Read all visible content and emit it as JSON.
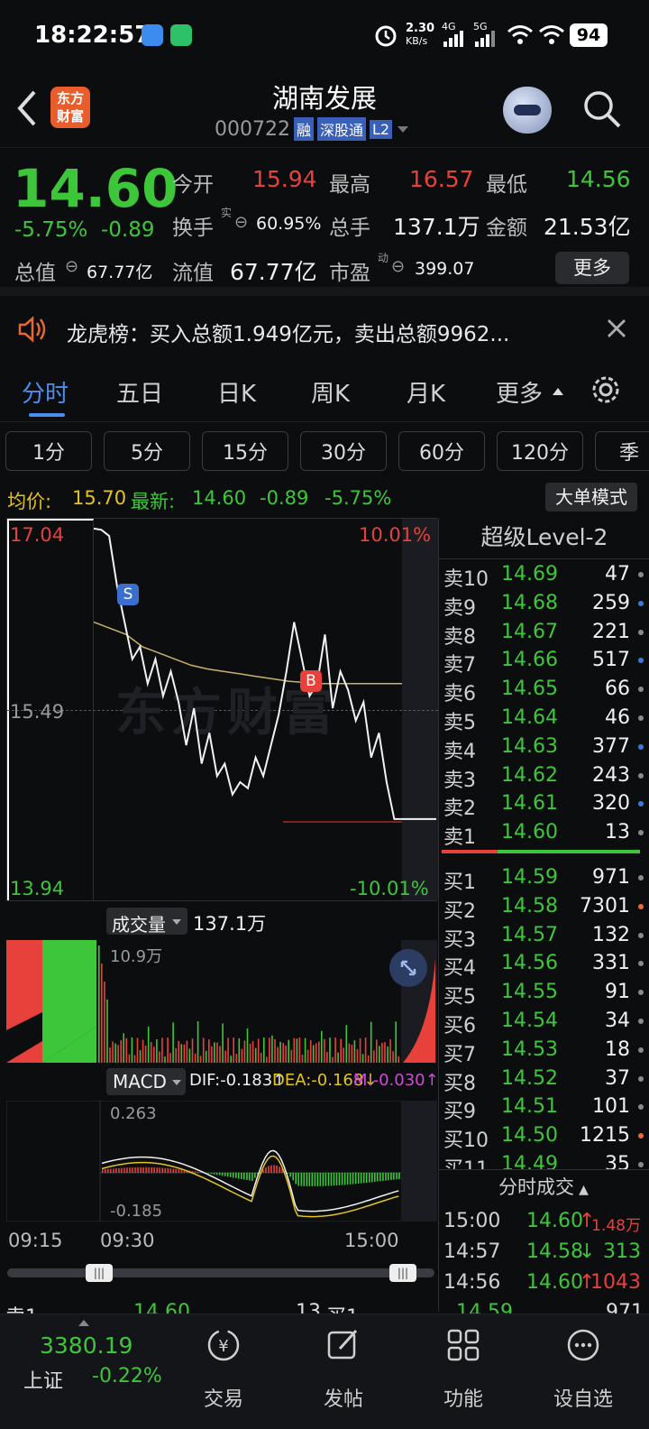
{
  "status_bar": {
    "time": "18:22:57",
    "net_speed_value": "2.30",
    "net_speed_unit": "KB/s",
    "net_4g": "4G",
    "net_5g": "5G",
    "battery": "94"
  },
  "header": {
    "title": "湖南发展",
    "code": "000722",
    "badge_margin": "融",
    "badge_connect": "深股通",
    "badge_level": "L2",
    "logo_line1": "东方",
    "logo_line2": "财富"
  },
  "quote": {
    "price": "14.60",
    "change_pct": "-5.75%",
    "change": "-0.89",
    "open_label": "今开",
    "open": "15.94",
    "high_label": "最高",
    "high": "16.57",
    "low_label": "最低",
    "low": "14.56",
    "turnover_label": "换手",
    "turnover_sup": "实",
    "turnover": "60.95%",
    "volume_label": "总手",
    "volume": "137.1万",
    "amount_label": "金额",
    "amount": "21.53亿",
    "mktcap_label": "总值",
    "mktcap": "67.77亿",
    "float_label": "流值",
    "float": "67.77亿",
    "pe_label": "市盈",
    "pe_sup": "动",
    "pe": "399.07",
    "more_button": "更多"
  },
  "notice": {
    "text": "龙虎榜：买入总额1.949亿元，卖出总额9962..."
  },
  "tabs": [
    "分时",
    "五日",
    "日K",
    "周K",
    "月K",
    "更多"
  ],
  "periods": [
    "1分",
    "5分",
    "15分",
    "30分",
    "60分",
    "120分",
    "季"
  ],
  "info_line": {
    "avg_label": "均价:",
    "avg": "15.70",
    "latest_label": "最新:",
    "latest": "14.60",
    "chg": "-0.89",
    "pct": "-5.75%",
    "big_order_button": "大单模式"
  },
  "chart": {
    "y_top": "17.04",
    "y_mid": "15.49",
    "y_bottom": "13.94",
    "pct_top": "10.01%",
    "pct_bottom": "-10.01%",
    "volume_label": "成交量",
    "volume_total": "137.1万",
    "volume_max": "10.9万",
    "macd_label": "MACD",
    "dif": "DIF:-0.183↑",
    "dea": "DEA:-0.168↓",
    "m": "M:-0.030↑",
    "macd_top": "0.263",
    "macd_bottom": "-0.185",
    "time_start": "09:15",
    "time_open": "09:30",
    "time_end": "15:00",
    "marker_s": "S",
    "marker_b": "B",
    "watermark": "东方财富"
  },
  "chart_data": {
    "type": "line",
    "title": "分时",
    "series": [
      {
        "name": "最新",
        "values": [
          16.96,
          16.95,
          16.9,
          16.5,
          16.2,
          15.9,
          16.0,
          15.7,
          15.9,
          15.6,
          15.8,
          15.55,
          15.2,
          15.5,
          15.05,
          15.3,
          14.95,
          15.05,
          14.8,
          14.9,
          14.85,
          15.1,
          14.95,
          15.2,
          15.45,
          15.8,
          16.2,
          15.9,
          15.6,
          15.7,
          16.1,
          15.5,
          15.8,
          15.65,
          15.4,
          15.55,
          15.1,
          15.3,
          14.9,
          14.6,
          14.6
        ]
      },
      {
        "name": "均价",
        "values": [
          16.2,
          16.15,
          16.1,
          16.0,
          15.95,
          15.9,
          15.85,
          15.82,
          15.8,
          15.78,
          15.76,
          15.74,
          15.72,
          15.71,
          15.7,
          15.7,
          15.7,
          15.7,
          15.7,
          15.7
        ]
      }
    ],
    "ylim": [
      13.94,
      17.04
    ],
    "xticks": [
      "09:15",
      "09:30",
      "15:00"
    ]
  },
  "order_book": {
    "title": "超级Level-2",
    "sells": [
      {
        "label": "卖10",
        "price": "14.69",
        "vol": "47",
        "dot": "#8a8a8a"
      },
      {
        "label": "卖9",
        "price": "14.68",
        "vol": "259",
        "dot": "#3a7bd5"
      },
      {
        "label": "卖8",
        "price": "14.67",
        "vol": "221",
        "dot": "#8a8a8a"
      },
      {
        "label": "卖7",
        "price": "14.66",
        "vol": "517",
        "dot": "#3a7bd5"
      },
      {
        "label": "卖6",
        "price": "14.65",
        "vol": "66",
        "dot": "#8a8a8a"
      },
      {
        "label": "卖5",
        "price": "14.64",
        "vol": "46",
        "dot": "#8a8a8a"
      },
      {
        "label": "卖4",
        "price": "14.63",
        "vol": "377",
        "dot": "#3a7bd5"
      },
      {
        "label": "卖3",
        "price": "14.62",
        "vol": "243",
        "dot": "#8a8a8a"
      },
      {
        "label": "卖2",
        "price": "14.61",
        "vol": "320",
        "dot": "#3a7bd5"
      },
      {
        "label": "卖1",
        "price": "14.60",
        "vol": "13",
        "dot": "#8a8a8a"
      }
    ],
    "buys": [
      {
        "label": "买1",
        "price": "14.59",
        "vol": "971",
        "dot": "#8a8a8a"
      },
      {
        "label": "买2",
        "price": "14.58",
        "vol": "7301",
        "dot": "#e86a3c"
      },
      {
        "label": "买3",
        "price": "14.57",
        "vol": "132",
        "dot": "#8a8a8a"
      },
      {
        "label": "买4",
        "price": "14.56",
        "vol": "331",
        "dot": "#8a8a8a"
      },
      {
        "label": "买5",
        "price": "14.55",
        "vol": "91",
        "dot": "#8a8a8a"
      },
      {
        "label": "买6",
        "price": "14.54",
        "vol": "34",
        "dot": "#8a8a8a"
      },
      {
        "label": "买7",
        "price": "14.53",
        "vol": "18",
        "dot": "#8a8a8a"
      },
      {
        "label": "买8",
        "price": "14.52",
        "vol": "37",
        "dot": "#8a8a8a"
      },
      {
        "label": "买9",
        "price": "14.51",
        "vol": "101",
        "dot": "#8a8a8a"
      },
      {
        "label": "买10",
        "price": "14.50",
        "vol": "1215",
        "dot": "#e86a3c"
      },
      {
        "label": "买11",
        "price": "14.49",
        "vol": "35",
        "dot": "#8a8a8a"
      }
    ],
    "trades_title": "分时成交",
    "trades": [
      {
        "time": "15:00",
        "price": "14.60",
        "arrow": "↑",
        "vol": "1.48万"
      },
      {
        "time": "14:57",
        "price": "14.58",
        "arrow": "↓",
        "vol": "313"
      },
      {
        "time": "14:56",
        "price": "14.60",
        "arrow": "↑",
        "vol": "1043"
      }
    ]
  },
  "bottom_strip": {
    "sell_label": "卖1",
    "sell_price": "14.60",
    "sell_vol": "13",
    "buy_label": "买1",
    "buy_price": "14.59",
    "buy_vol": "971"
  },
  "bottom_nav": {
    "index_value": "3380.19",
    "index_name": "上证",
    "index_change": "-0.22%",
    "items": [
      "交易",
      "发帖",
      "功能",
      "设自选"
    ]
  }
}
